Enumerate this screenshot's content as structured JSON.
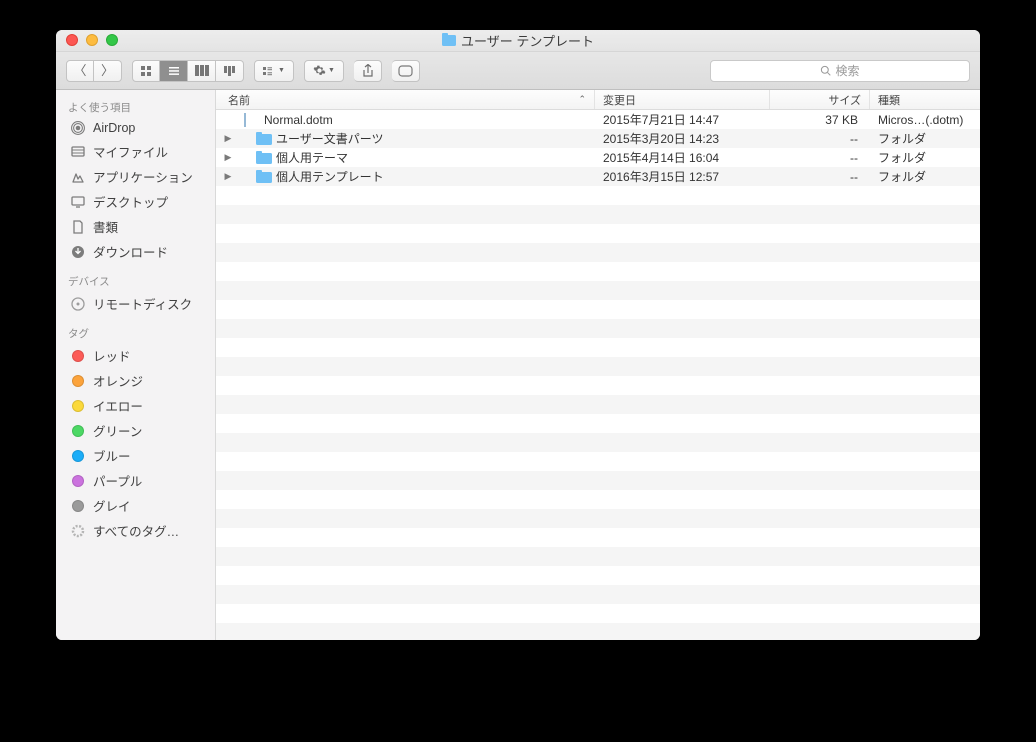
{
  "window": {
    "title": "ユーザー テンプレート"
  },
  "toolbar": {
    "search_placeholder": "検索"
  },
  "sidebar": {
    "favorites_header": "よく使う項目",
    "favorites": [
      {
        "label": "AirDrop",
        "icon": "airdrop"
      },
      {
        "label": "マイファイル",
        "icon": "myfiles"
      },
      {
        "label": "アプリケーション",
        "icon": "applications"
      },
      {
        "label": "デスクトップ",
        "icon": "desktop"
      },
      {
        "label": "書類",
        "icon": "documents"
      },
      {
        "label": "ダウンロード",
        "icon": "downloads"
      }
    ],
    "devices_header": "デバイス",
    "devices": [
      {
        "label": "リモートディスク",
        "icon": "remotedisc"
      }
    ],
    "tags_header": "タグ",
    "tags": [
      {
        "label": "レッド",
        "color": "#fc5b57"
      },
      {
        "label": "オレンジ",
        "color": "#fca33b"
      },
      {
        "label": "イエロー",
        "color": "#fbd93b"
      },
      {
        "label": "グリーン",
        "color": "#4cd864"
      },
      {
        "label": "ブルー",
        "color": "#1badf8"
      },
      {
        "label": "パープル",
        "color": "#cb72de"
      },
      {
        "label": "グレイ",
        "color": "#9a9a9a"
      }
    ],
    "all_tags": "すべてのタグ…"
  },
  "columns": {
    "name": "名前",
    "date": "変更日",
    "size": "サイズ",
    "kind": "種類"
  },
  "rows": [
    {
      "disclosure": false,
      "icon": "doc",
      "name": "Normal.dotm",
      "date": "2015年7月21日 14:47",
      "size": "37 KB",
      "kind": "Micros…(.dotm)"
    },
    {
      "disclosure": true,
      "icon": "folder",
      "name": "ユーザー文書パーツ",
      "date": "2015年3月20日 14:23",
      "size": "--",
      "kind": "フォルダ"
    },
    {
      "disclosure": true,
      "icon": "folder",
      "name": "個人用テーマ",
      "date": "2015年4月14日 16:04",
      "size": "--",
      "kind": "フォルダ"
    },
    {
      "disclosure": true,
      "icon": "folder",
      "name": "個人用テンプレート",
      "date": "2016年3月15日 12:57",
      "size": "--",
      "kind": "フォルダ"
    }
  ]
}
